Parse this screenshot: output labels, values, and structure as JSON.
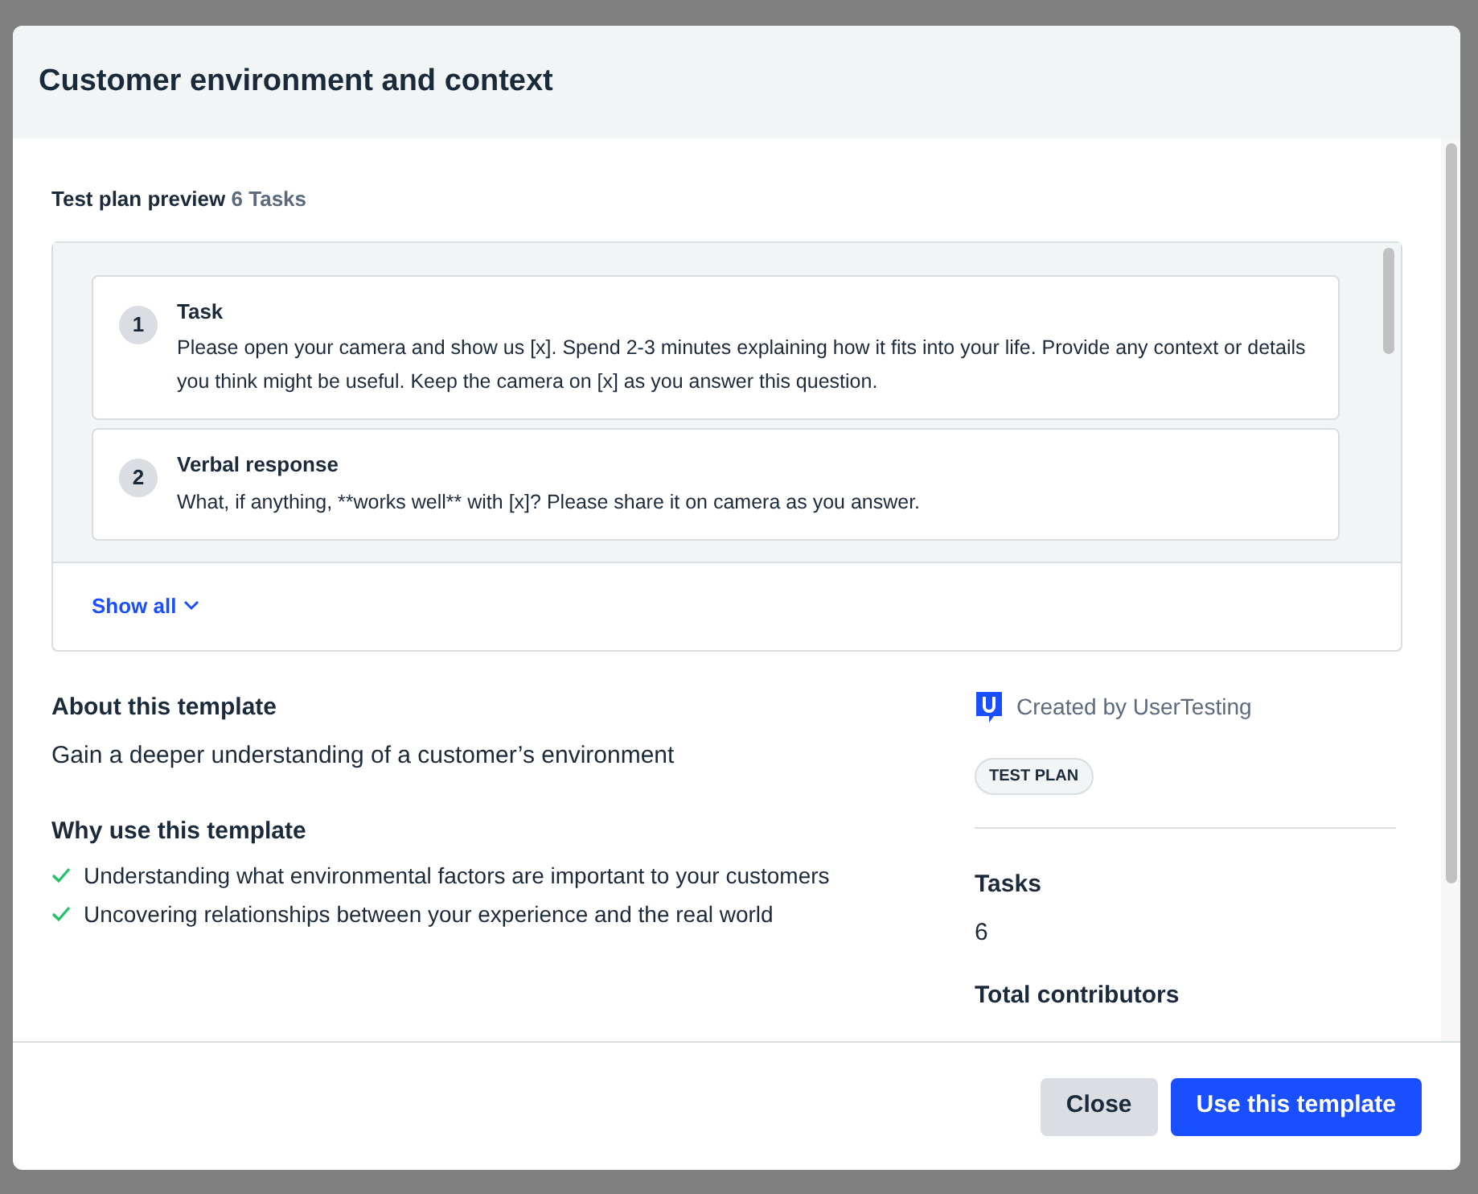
{
  "dialog": {
    "title": "Customer environment and context"
  },
  "preview": {
    "label": "Test plan preview",
    "count": "6 Tasks",
    "show_all": "Show all",
    "tasks": [
      {
        "number": "1",
        "type": "Task",
        "text": "Please open your camera and show us [x]. Spend 2-3 minutes explaining how it fits into your life. Provide any context or details you think might be useful. Keep the camera on [x] as you answer this question."
      },
      {
        "number": "2",
        "type": "Verbal response",
        "text": "What, if anything, **works well** with [x]? Please share it on camera as you answer."
      }
    ]
  },
  "about": {
    "heading": "About this template",
    "text": "Gain a deeper understanding of a customer’s environment"
  },
  "why": {
    "heading": "Why use this template",
    "items": [
      "Understanding what environmental factors are important to your customers",
      "Uncovering relationships between your experience and the real world"
    ]
  },
  "sidebar": {
    "creator": "Created by UserTesting",
    "tag": "TEST PLAN",
    "stats": [
      {
        "label": "Tasks",
        "value": "6"
      },
      {
        "label": "Total contributors"
      }
    ]
  },
  "buttons": [
    {
      "label": "Close",
      "kind": "secondary"
    },
    {
      "label": "Use this template",
      "kind": "primary"
    }
  ]
}
